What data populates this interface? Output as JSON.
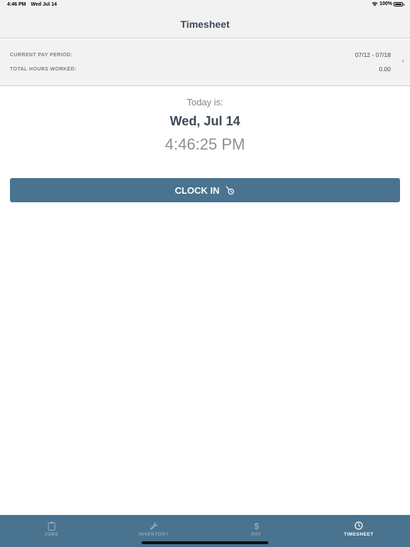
{
  "status_bar": {
    "time": "4:46 PM",
    "date": "Wed Jul 14",
    "battery": "100%",
    "wifi_icon": "wifi-icon",
    "battery_icon": "battery-icon"
  },
  "nav": {
    "title": "Timesheet"
  },
  "summary": {
    "pay_period_label": "CURRENT PAY PERIOD:",
    "pay_period_value": "07/12 - 07/18",
    "hours_label": "TOTAL HOURS WORKED:",
    "hours_value": "0.00",
    "chevron": "›"
  },
  "today": {
    "label": "Today is:",
    "date": "Wed, Jul 14",
    "time": "4:46:25 PM"
  },
  "clock_button": {
    "label": "CLOCK IN",
    "icon": "clock-in-icon"
  },
  "tabs": [
    {
      "label": "JOBS",
      "icon": "clipboard-icon",
      "active": false
    },
    {
      "label": "INVENTORY",
      "icon": "wrench-icon",
      "active": false
    },
    {
      "label": "PAY",
      "icon": "dollar-icon",
      "active": false
    },
    {
      "label": "TIMESHEET",
      "icon": "clock-icon",
      "active": true
    }
  ],
  "colors": {
    "primary": "#4a7390",
    "header_bg": "#f2f2f2",
    "text_dark": "#3d4a57",
    "text_muted": "#80868d",
    "tab_inactive": "#8fa9bc"
  }
}
